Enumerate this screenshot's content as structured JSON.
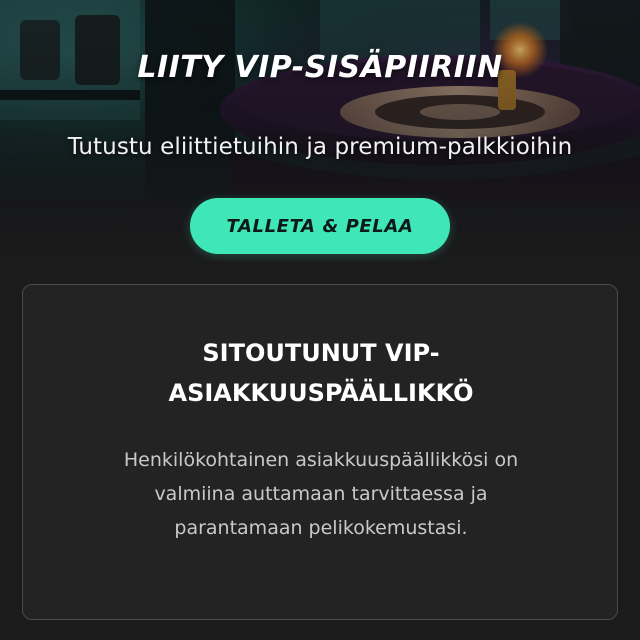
{
  "hero": {
    "title": "LIITY VIP-SISÄPIIRIIN",
    "subtitle": "Tutustu eliittietuihin ja premium-palkkioihin",
    "cta_label": "TALLETA & PELAA"
  },
  "card": {
    "title_line1": "SITOUTUNUT VIP-",
    "title_line2": "ASIAKKUUSPÄÄLLIKKÖ",
    "body_line1": "Henkilökohtainen asiakkuuspäällikkösi on",
    "body_line2": "valmiina auttamaan tarvittaessa ja",
    "body_line3": "parantamaan pelikokemustasi."
  },
  "colors": {
    "accent": "#3fe6b8",
    "background": "#1b1b1b",
    "card_background": "#232323",
    "card_border": "#4a4a4a",
    "text_primary": "#ffffff",
    "text_secondary": "#c9c9c9"
  }
}
